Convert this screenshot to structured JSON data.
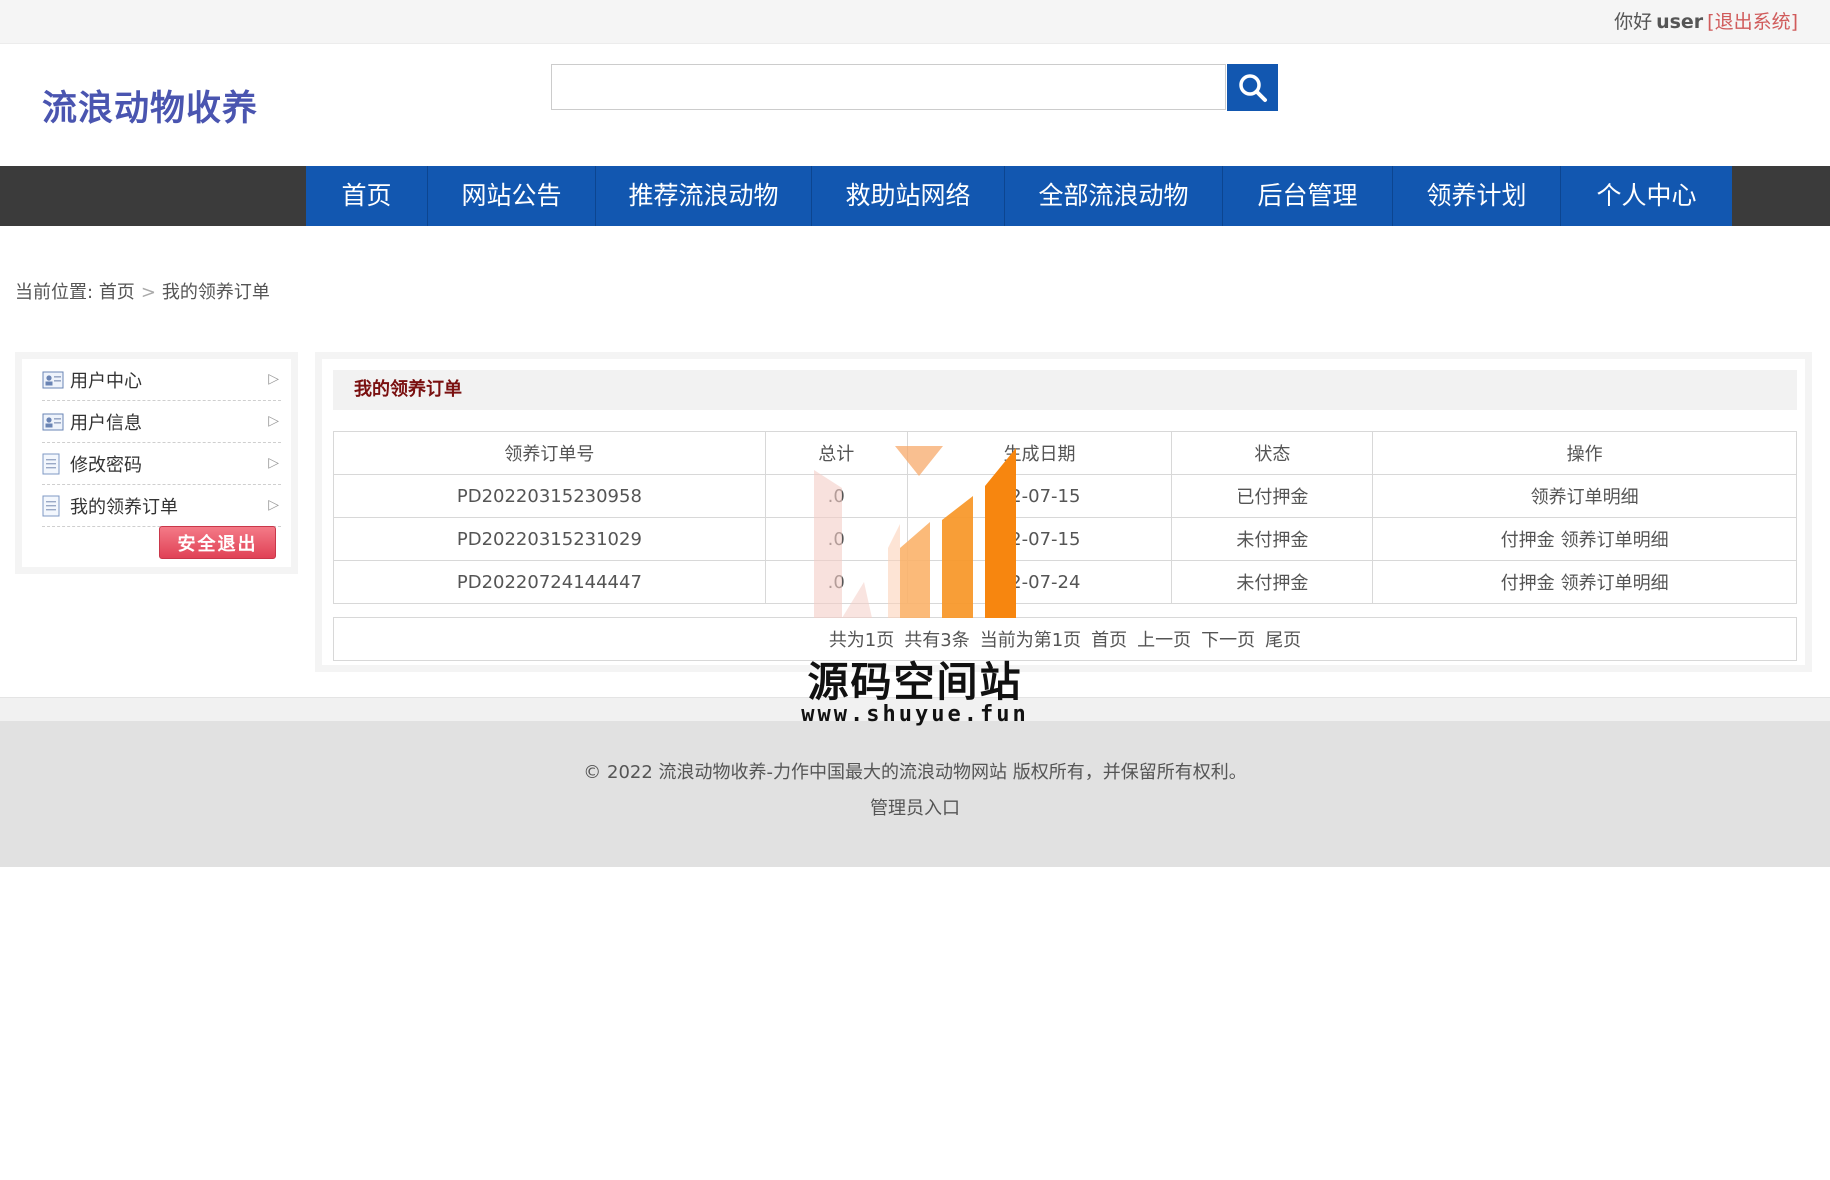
{
  "topbar": {
    "greeting": "你好",
    "username": "user",
    "logout_label": "[退出系统]"
  },
  "header": {
    "logo_text": "流浪动物收养",
    "search_placeholder": ""
  },
  "nav": {
    "items": [
      "首页",
      "网站公告",
      "推荐流浪动物",
      "救助站网络",
      "全部流浪动物",
      "后台管理",
      "领养计划",
      "个人中心"
    ]
  },
  "breadcrumb": {
    "prefix": "当前位置:",
    "home": "首页",
    "separator": ">",
    "current": "我的领养订单"
  },
  "sidebar": {
    "items": [
      {
        "label": "用户中心",
        "icon": "id-card-icon"
      },
      {
        "label": "用户信息",
        "icon": "id-card-icon"
      },
      {
        "label": "修改密码",
        "icon": "document-icon"
      },
      {
        "label": "我的领养订单",
        "icon": "document-icon"
      }
    ],
    "exit_label": "安全退出"
  },
  "panel": {
    "title": "我的领养订单",
    "columns": [
      "领养订单号",
      "总计",
      "生成日期",
      "状态",
      "操作"
    ],
    "rows": [
      {
        "order_no": "PD20220315230958",
        "total": ".0",
        "date": "22-07-15",
        "status": "已付押金",
        "actions": [
          "领养订单明细"
        ]
      },
      {
        "order_no": "PD20220315231029",
        "total": ".0",
        "date": "22-07-15",
        "status": "未付押金",
        "actions": [
          "付押金",
          "领养订单明细"
        ]
      },
      {
        "order_no": "PD20220724144447",
        "total": ".0",
        "date": "22-07-24",
        "status": "未付押金",
        "actions": [
          "付押金",
          "领养订单明细"
        ]
      }
    ],
    "pager": {
      "total_pages": "共为1页",
      "total_items": "共有3条",
      "current_page": "当前为第1页",
      "first": "首页",
      "prev": "上一页",
      "next": "下一页",
      "last": "尾页"
    }
  },
  "footer": {
    "copyright": "© 2022 流浪动物收养-力作中国最大的流浪动物网站 版权所有，并保留所有权利。",
    "admin_link": "管理员入口"
  },
  "watermark": {
    "title": "源码空间站",
    "url": "www.shuyue.fun"
  },
  "colors": {
    "nav_blue": "#1257b0",
    "nav_dark": "#3b3b3b",
    "logo": "#4a55b0",
    "panel_title": "#7a1010",
    "logout": "#d05b5b",
    "watermark_orange": "#f7860f"
  }
}
